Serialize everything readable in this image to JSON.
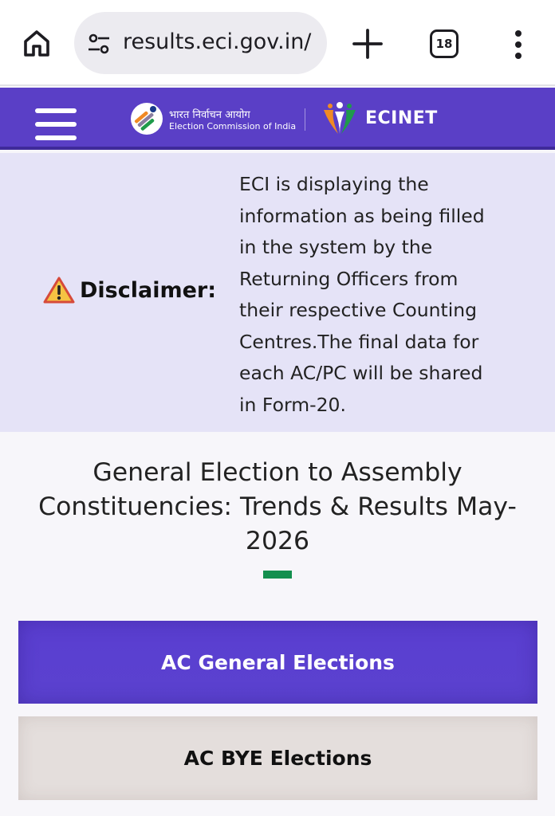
{
  "browser": {
    "url": "results.eci.gov.in/",
    "tab_count": "18",
    "icons": {
      "home": "home-icon",
      "site_settings": "tune-icon",
      "new_tab": "plus-icon",
      "tabs": "tab-switcher-icon",
      "menu": "more-vert-icon"
    }
  },
  "header": {
    "eci_name_hindi": "भारत निर्वाचन आयोग",
    "eci_name_english": "Election Commission of India",
    "brand": "ECINET",
    "colors": {
      "background": "#5a3fc6",
      "text": "#ffffff"
    }
  },
  "disclaimer": {
    "label": "Disclaimer:",
    "lines": [
      "ECI is displaying the",
      "information as being filled",
      "in the system by the",
      "Returning Officers from",
      "their respective Counting",
      "Centres.The final data for",
      "each AC/PC will be shared",
      "in Form-20."
    ],
    "colors": {
      "background": "#e5e3f7"
    }
  },
  "main": {
    "title_lines": [
      "General Election to Assembly",
      "Constituencies: Trends & Results May-",
      "2026"
    ],
    "accent_color": "#138f4e",
    "buttons": {
      "general": "AC General Elections",
      "bye": "AC BYE Elections"
    },
    "colors": {
      "general_bg": "#5a3ed0",
      "bye_bg": "#e4dedc"
    }
  }
}
